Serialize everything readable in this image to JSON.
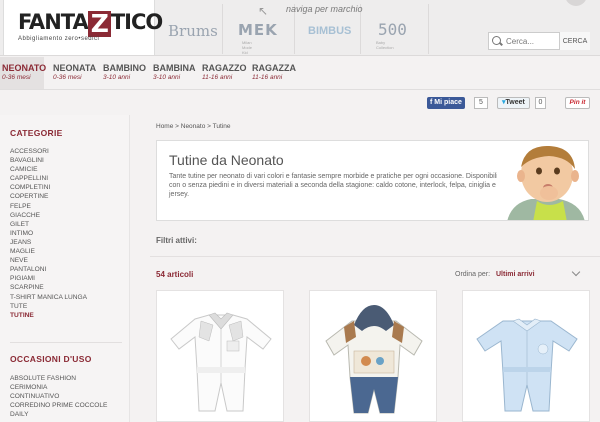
{
  "header": {
    "logo_text_start": "FANTA",
    "logo_letter": "Z",
    "logo_text_end": "TICO",
    "logo_tagline": "Abbigliamento zero•sedici",
    "naviga_label": "naviga per marchio",
    "brands": [
      {
        "name": "Brums"
      },
      {
        "name": "MEK",
        "tagline": "Milan Mode Kid"
      },
      {
        "name": "BIMBUS",
        "tagline": ""
      },
      {
        "name": "500",
        "tagline": "Baby Collection"
      }
    ],
    "search": {
      "placeholder": "Cerca...",
      "button_label": "CERCA"
    }
  },
  "nav": [
    {
      "title": "NEONATO",
      "sub": "0-36 mesi",
      "active": true
    },
    {
      "title": "NEONATA",
      "sub": "0-36 mesi"
    },
    {
      "title": "BAMBINO",
      "sub": "3-10 anni"
    },
    {
      "title": "BAMBINA",
      "sub": "3-10 anni"
    },
    {
      "title": "RAGAZZO",
      "sub": "11-16 anni"
    },
    {
      "title": "RAGAZZA",
      "sub": "11-16 anni"
    }
  ],
  "social": {
    "facebook_label": "Mi piace",
    "facebook_count": "5",
    "twitter_label": "Tweet",
    "twitter_count": "0",
    "pinterest_label": "Pin it"
  },
  "sidebar": {
    "categories_title": "CATEGORIE",
    "categories": [
      "ACCESSORI",
      "BAVAGLINI",
      "CAMICIE",
      "CAPPELLINI",
      "COMPLETINI",
      "COPERTINE",
      "FELPE",
      "GIACCHE",
      "GILET",
      "INTIMO",
      "JEANS",
      "MAGLIE",
      "NEVE",
      "PANTALONI",
      "PIGIAMI",
      "SCARPINE",
      "T-SHIRT MANICA LUNGA",
      "TUTE",
      "TUTINE"
    ],
    "active_category": "TUTINE",
    "occasions_title": "OCCASIONI D'USO",
    "occasions": [
      "ABSOLUTE FASHION",
      "CERIMONIA",
      "CONTINUATIVO",
      "CORREDINO PRIME COCCOLE",
      "DAILY"
    ]
  },
  "main": {
    "breadcrumb": "Home > Neonato > Tutine",
    "hero_title": "Tutine da Neonato",
    "hero_text": "Tante tutine per neonato di vari colori e fantasie sempre morbide e pratiche per ogni occasione. Disponibili con o senza piedini e in diversi materiali a seconda della stagione: caldo cotone, interlock, felpa, ciniglia e jersey.",
    "filters_label": "Filtri attivi:",
    "count_label": "54 articoli",
    "sort_label": "Ordina per:",
    "sort_value": "Ultimi arrivi"
  },
  "colors": {
    "accent": "#8b2a35",
    "facebook": "#3b5998",
    "pinterest": "#c8232c"
  },
  "icons": [
    "search-icon",
    "chevron-down-icon",
    "naviga-arrow-icon"
  ]
}
